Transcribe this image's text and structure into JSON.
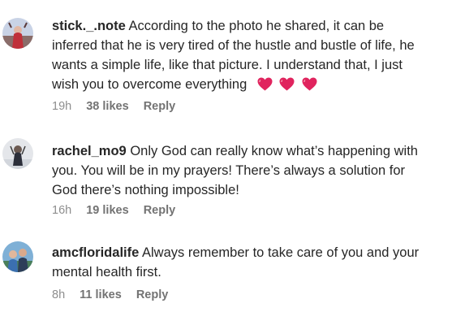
{
  "comments": [
    {
      "username": "stick._.note",
      "lines": [
        "According to the photo he shared, it can be",
        "inferred that he is very tired of the hustle and bustle of life, he",
        "wants a simple life, like that picture. I understand that, I just",
        "wish you to overcome everything"
      ],
      "emoji": [
        "red-heart-emoji",
        "red-heart-emoji",
        "red-heart-emoji"
      ],
      "time": "19h",
      "likes": "38 likes",
      "reply": "Reply"
    },
    {
      "username": "rachel_mo9",
      "lines": [
        "Only God can really know what’s happening with",
        "you. You will be in my prayers! There’s always a solution for",
        "God there’s nothing impossible!"
      ],
      "time": "16h",
      "likes": "19 likes",
      "reply": "Reply"
    },
    {
      "username": "amcfloridalife",
      "lines": [
        "Always remember to take care of you and your",
        "mental health first."
      ],
      "time": "8h",
      "likes": "11 likes",
      "reply": "Reply"
    }
  ],
  "colors": {
    "text": "#262626",
    "meta": "#8e8e8e",
    "heart": "#e0245e"
  }
}
